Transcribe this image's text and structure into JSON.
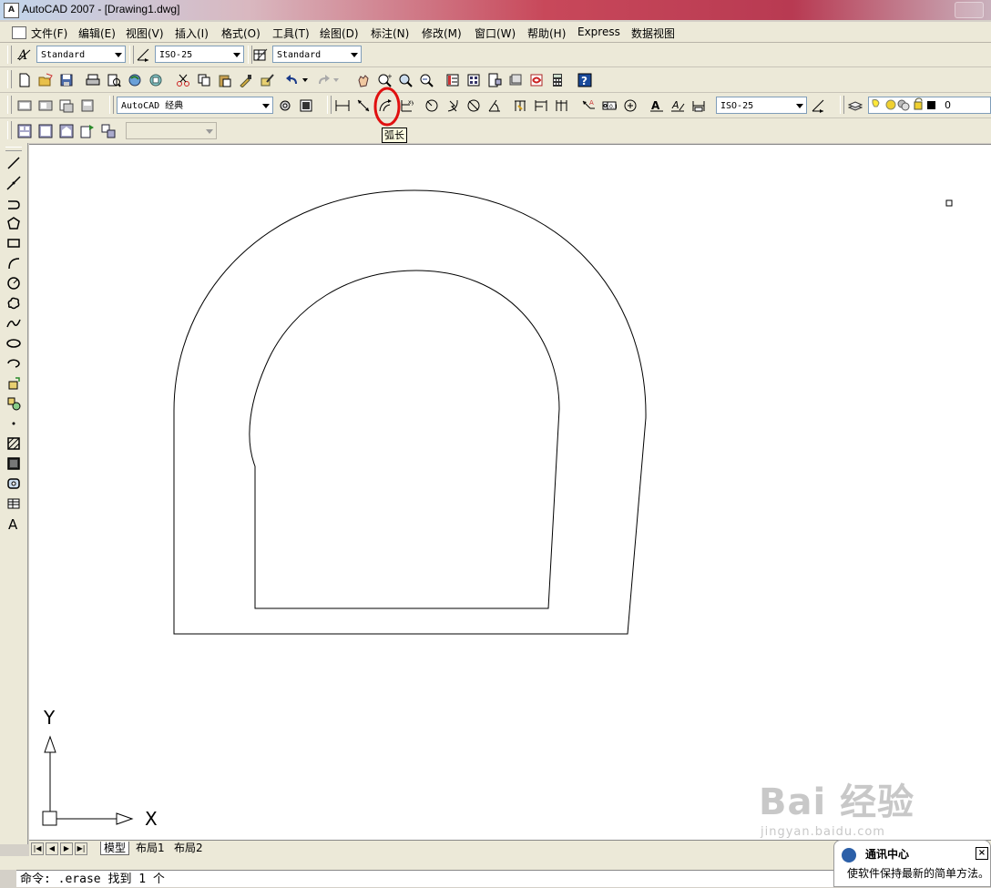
{
  "window": {
    "title": "AutoCAD 2007 - [Drawing1.dwg]",
    "app_icon_text": "A"
  },
  "menu": [
    "文件(F)",
    "编辑(E)",
    "视图(V)",
    "插入(I)",
    "格式(O)",
    "工具(T)",
    "绘图(D)",
    "标注(N)",
    "修改(M)",
    "窗口(W)",
    "帮助(H)",
    "Express",
    "数据视图"
  ],
  "styles_toolbar": {
    "text_style": "Standard",
    "dim_style": "ISO-25",
    "table_style": "Standard"
  },
  "workspace_toolbar": {
    "workspace": "AutoCAD 经典"
  },
  "dimension_toolbar": {
    "dim_style": "ISO-25",
    "highlighted_tool": "arc-length-dimension",
    "highlight_color": "#e01010"
  },
  "layers_toolbar": {
    "layer_name": "0"
  },
  "tooltip": {
    "text": "弧长"
  },
  "ucs": {
    "x_label": "X",
    "y_label": "Y"
  },
  "layout_tabs": [
    "模型",
    "布局1",
    "布局2"
  ],
  "active_tab": "模型",
  "command_line": {
    "text": "命令:  .erase 找到 1 个"
  },
  "comm_center": {
    "title": "通讯中心",
    "body": "使软件保持最新的简单方法。"
  },
  "watermark": {
    "brand": "Bai 经验",
    "url": "jingyan.baidu.com"
  }
}
